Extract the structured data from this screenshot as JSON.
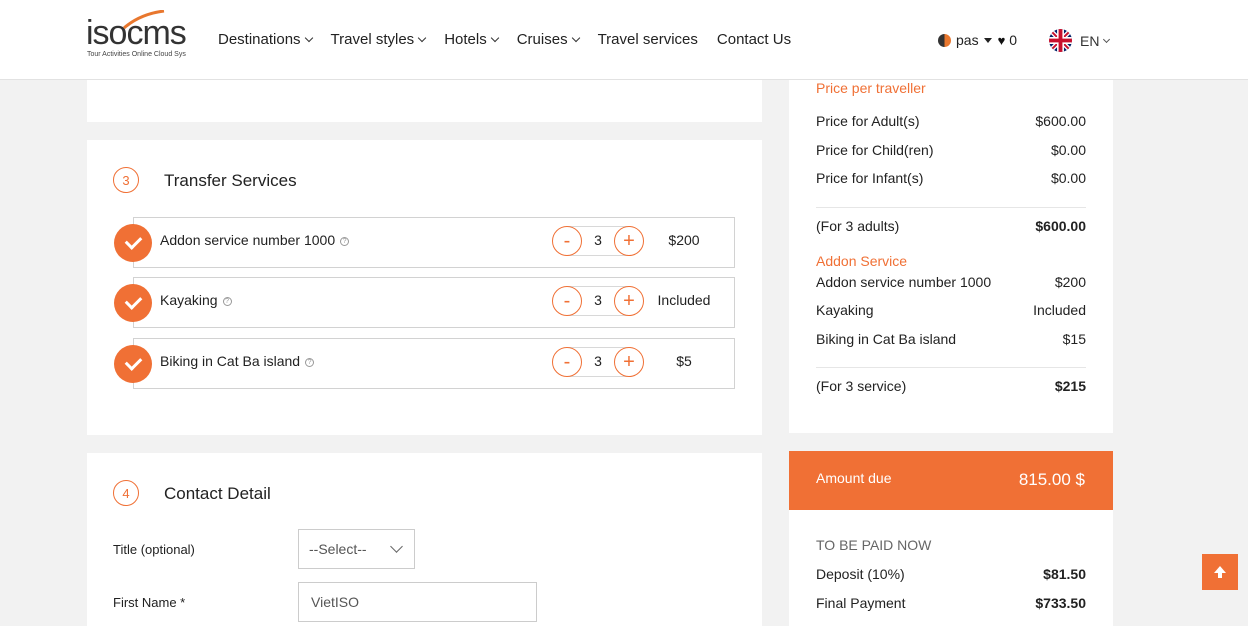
{
  "header": {
    "logo_text": "isocms",
    "logo_tagline": "Tour Activities Online Cloud Sys",
    "nav": [
      {
        "label": "Destinations",
        "dropdown": true
      },
      {
        "label": "Travel styles",
        "dropdown": true
      },
      {
        "label": "Hotels",
        "dropdown": true
      },
      {
        "label": "Cruises",
        "dropdown": true
      },
      {
        "label": "Travel services",
        "dropdown": false
      },
      {
        "label": "Contact Us",
        "dropdown": false
      }
    ],
    "user": "pas",
    "wishlist_count": "0",
    "language": "EN"
  },
  "transfer": {
    "step": "3",
    "title": "Transfer Services",
    "addons": [
      {
        "name": "Addon service number 1000",
        "qty": "3",
        "price": "$200",
        "checked": true
      },
      {
        "name": "Kayaking",
        "qty": "3",
        "price": "Included",
        "checked": true
      },
      {
        "name": "Biking in Cat Ba island",
        "qty": "3",
        "price": "$5",
        "checked": true
      }
    ],
    "minus_label": "-",
    "plus_label": "+"
  },
  "contact": {
    "step": "4",
    "title": "Contact Detail",
    "title_label": "Title (optional)",
    "title_select_value": "--Select--",
    "first_name_label": "First Name *",
    "first_name_value": "VietISO"
  },
  "summary": {
    "price_heading": "Price per traveller",
    "adult_label": "Price for Adult(s)",
    "adult_value": "$600.00",
    "child_label": "Price for Child(ren)",
    "child_value": "$0.00",
    "infant_label": "Price for Infant(s)",
    "infant_value": "$0.00",
    "subtotal_label": "(For 3 adults)",
    "subtotal_value": "$600.00",
    "addon_heading": "Addon Service",
    "addons": [
      {
        "name": "Addon service number 1000",
        "price": "$200"
      },
      {
        "name": "Kayaking",
        "price": "Included"
      },
      {
        "name": "Biking in Cat Ba island",
        "price": "$15"
      }
    ],
    "addon_total_label": "(For 3 service)",
    "addon_total_value": "$215"
  },
  "amount_due": {
    "label": "Amount due",
    "value": "815.00 $"
  },
  "payment": {
    "heading": "TO BE PAID NOW",
    "deposit_label": "Deposit (10%)",
    "deposit_value": "$81.50",
    "final_label": "Final Payment",
    "final_value": "$733.50"
  },
  "colors": {
    "accent": "#f07035",
    "background": "#f2f2f2"
  }
}
